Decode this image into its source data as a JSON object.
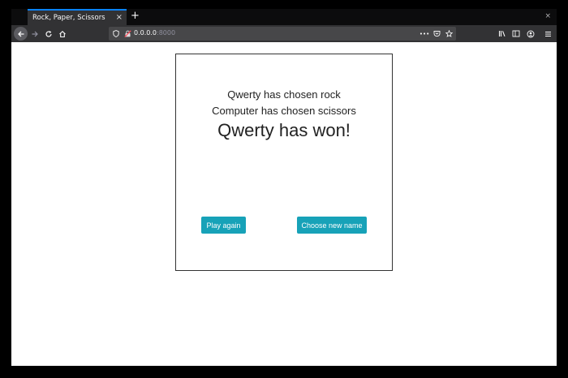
{
  "browser": {
    "tab_title": "Rock, Paper, Scissors",
    "tab_close": "×",
    "new_tab": "+",
    "window_close": "×",
    "url_host": "0.0.0.0",
    "url_port": ":8000",
    "url_menu": "•••"
  },
  "game": {
    "player_choice": "Qwerty has chosen rock",
    "computer_choice": "Computer has chosen scissors",
    "result": "Qwerty has won!",
    "play_again_label": "Play again",
    "new_name_label": "Choose new name"
  },
  "colors": {
    "accent": "#17a2b8",
    "tab_highlight": "#0a84ff"
  }
}
